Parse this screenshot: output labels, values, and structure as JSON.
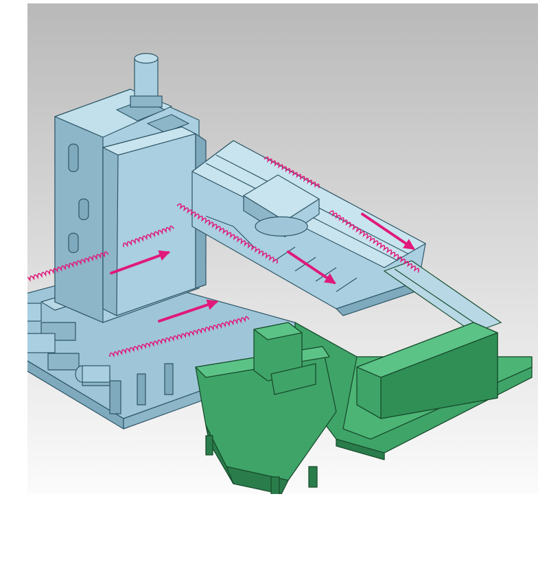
{
  "figure": {
    "description_visible_text": "",
    "colors": {
      "machine_body": "#a9cfe0",
      "machine_shadow": "#7fa9bd",
      "machine_outline": "#2e5566",
      "chip_conveyor": "#3fa468",
      "chip_conveyor_dark": "#2a7d4b",
      "conveyor_outline": "#174c2c",
      "coil_and_arrows": "#e0197a",
      "background_top": "#bdbdbd",
      "background_bottom": "#f7f7f7"
    },
    "arrows": [
      {
        "name": "column-arrow-upper"
      },
      {
        "name": "column-arrow-lower"
      },
      {
        "name": "table-arrow-front"
      },
      {
        "name": "table-arrow-rear"
      }
    ],
    "coils": [
      {
        "name": "coil-column-upper"
      },
      {
        "name": "coil-column-lower"
      },
      {
        "name": "coil-base-front"
      },
      {
        "name": "coil-table-left"
      },
      {
        "name": "coil-table-right"
      },
      {
        "name": "coil-table-rear"
      }
    ]
  }
}
